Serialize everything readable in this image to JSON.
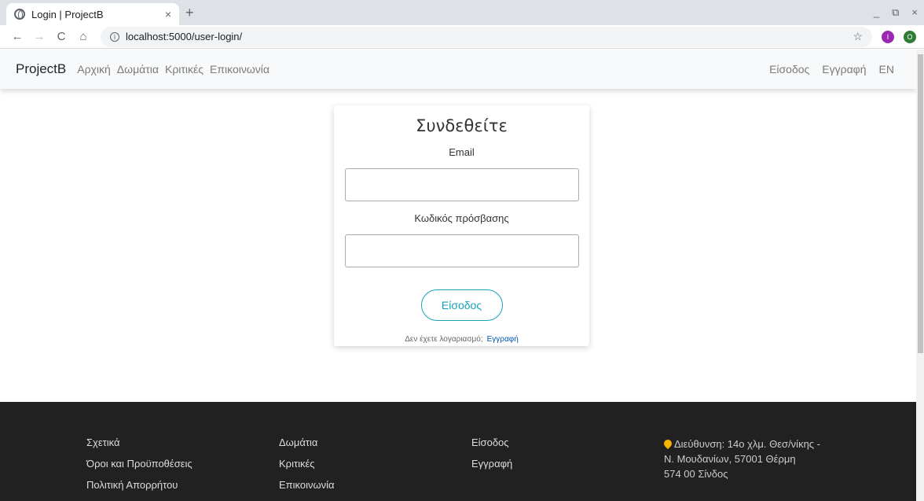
{
  "browser": {
    "tab_title": "Login | ProjectB",
    "tab_close": "×",
    "new_tab": "+",
    "url": "localhost:5000/user-login/",
    "back": "←",
    "forward": "→",
    "reload": "C",
    "home": "⌂",
    "star": "☆",
    "ext1": "I",
    "ext2": "O",
    "win_min": "_",
    "win_restore": "⧉",
    "win_close": "×"
  },
  "nav": {
    "brand": "ProjectB",
    "links": [
      "Αρχική",
      "Δωμάτια",
      "Κριτικές",
      "Επικοινωνία"
    ],
    "right_links": [
      "Είσοδος",
      "Εγγραφή",
      "EN"
    ]
  },
  "login": {
    "title": "Συνδεθείτε",
    "email_label": "Email",
    "email_value": "",
    "password_label": "Κωδικός πρόσβασης",
    "password_value": "",
    "submit_label": "Είσοδος",
    "no_account": "Δεν έχετε λογαριασμό;",
    "register_link": "Εγγραφή"
  },
  "footer": {
    "col1": [
      "Σχετικά",
      "Όροι και Προϋποθέσεις",
      "Πολιτική Απορρήτου"
    ],
    "col2": [
      "Δωμάτια",
      "Κριτικές",
      "Επικοινωνία"
    ],
    "col3": [
      "Είσοδος",
      "Εγγραφή"
    ],
    "address": "Διεύθυνση: 14ο χλμ. Θεσ/νίκης - Ν. Μουδανίων, 57001 Θέρμη",
    "address2": "574 00 Σίνδος"
  },
  "colors": {
    "accent": "#17a2b8",
    "footer_bg": "#212121",
    "pin": "#f5b400"
  }
}
